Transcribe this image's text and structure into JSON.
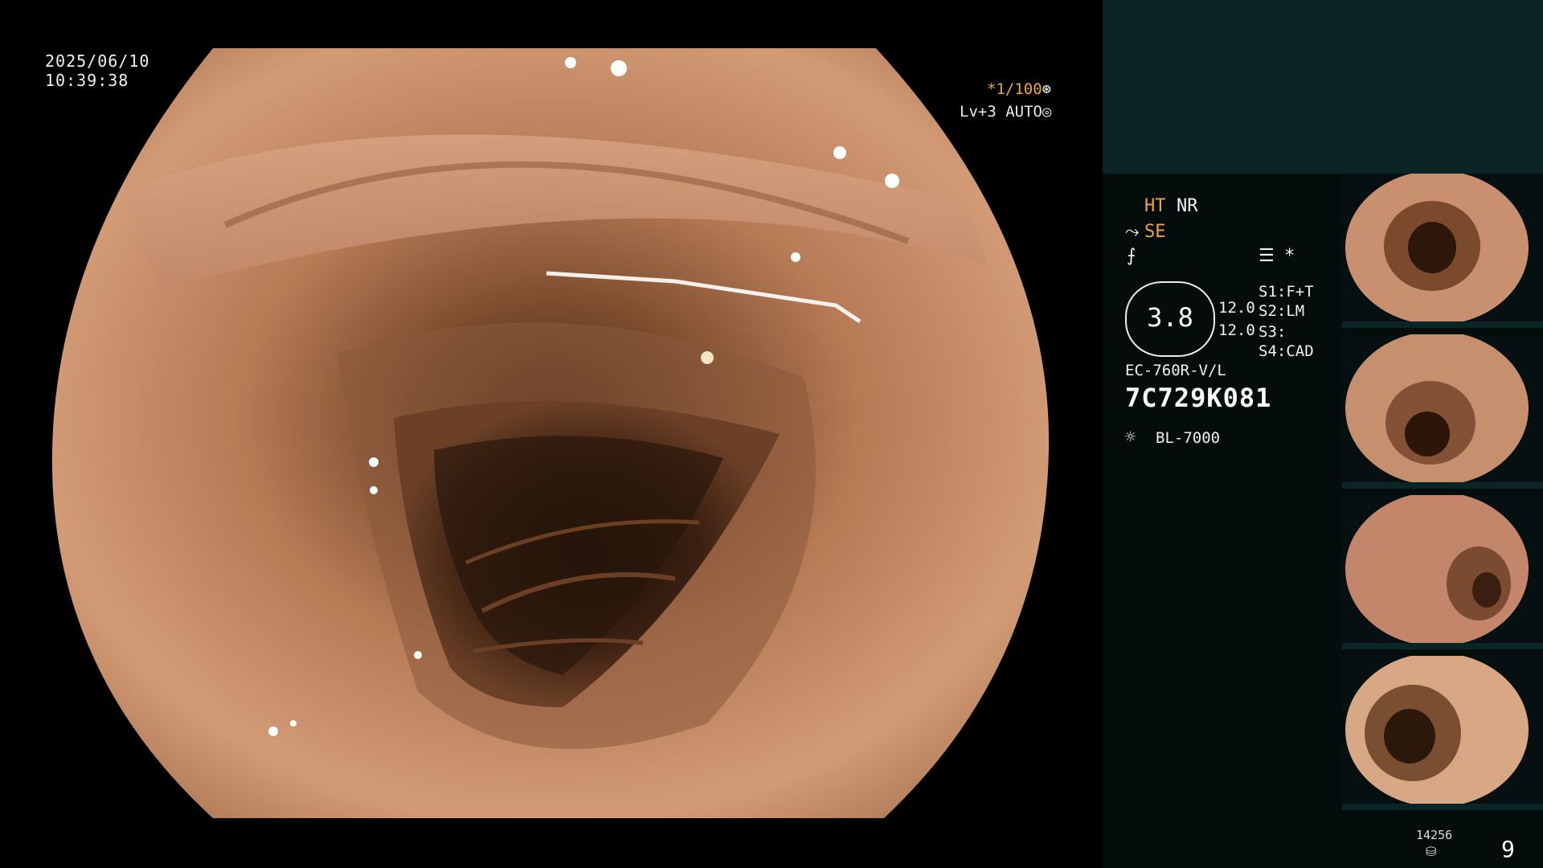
{
  "overlay": {
    "date": "2025/06/10",
    "time": "10:39:38",
    "shutter": "*1/100",
    "level": "Lv+3",
    "iris_mode": "AUTO"
  },
  "modes": {
    "ht": "HT",
    "nr": "NR",
    "se": "SE",
    "asterisk": "*"
  },
  "gauge": {
    "value": "3.8",
    "top_value": "12.0",
    "bottom_value": "12.0"
  },
  "switches": {
    "s1_label": "S1:",
    "s1_value": "F+T",
    "s2_label": "S2:",
    "s2_value": "LM",
    "s3_label": "S3:",
    "s3_value": "",
    "s4_label": "S4:",
    "s4_value": "CAD"
  },
  "scope": {
    "model": "EC-760R-V/L",
    "serial": "7C729K081",
    "light_source": "BL-7000"
  },
  "footer": {
    "image_count": "14256",
    "page_number": "9"
  },
  "icons": {
    "shutter": "shutter-icon",
    "iris": "iris-icon",
    "se_mode": "scope-tip-icon",
    "enhance": "enhance-icon",
    "menu": "menu-icon",
    "light": "sun-icon",
    "storage": "storage-icon"
  },
  "colors": {
    "accent": "#f2a33a",
    "panel_top": "#0b2426",
    "panel_bottom": "#050c0c"
  }
}
